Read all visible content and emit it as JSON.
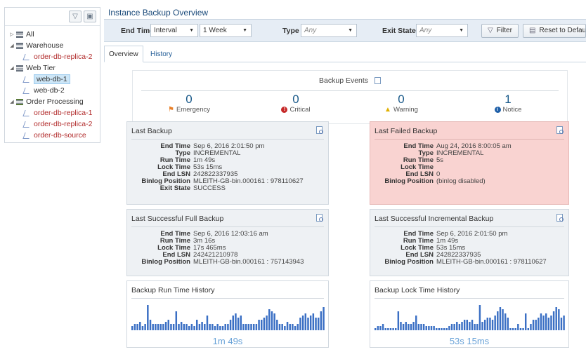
{
  "tree": {
    "items": [
      {
        "label": "All",
        "level": 0,
        "kind": "group",
        "expand": "closed",
        "color": "normal"
      },
      {
        "label": "Warehouse",
        "level": 0,
        "kind": "group",
        "expand": "open",
        "color": "normal"
      },
      {
        "label": "order-db-replica-2",
        "level": 1,
        "kind": "instance",
        "expand": "none",
        "color": "red"
      },
      {
        "label": "Web Tier",
        "level": 0,
        "kind": "group",
        "expand": "open",
        "color": "normal"
      },
      {
        "label": "web-db-1",
        "level": 1,
        "kind": "instance",
        "expand": "none",
        "color": "normal",
        "selected": true
      },
      {
        "label": "web-db-2",
        "level": 1,
        "kind": "instance",
        "expand": "none",
        "color": "normal"
      },
      {
        "label": "Order Processing",
        "level": 0,
        "kind": "group-green",
        "expand": "open",
        "color": "normal"
      },
      {
        "label": "order-db-replica-1",
        "level": 1,
        "kind": "instance",
        "expand": "none",
        "color": "red"
      },
      {
        "label": "order-db-replica-2",
        "level": 1,
        "kind": "instance",
        "expand": "none",
        "color": "red"
      },
      {
        "label": "order-db-source",
        "level": 1,
        "kind": "instance",
        "expand": "none",
        "color": "red"
      }
    ]
  },
  "header": {
    "title": "Instance Backup Overview"
  },
  "filters": {
    "end_time_label": "End Time",
    "end_time_mode": "Interval",
    "end_time_range": "1 Week",
    "type_label": "Type",
    "type_value": "Any",
    "exit_state_label": "Exit State",
    "exit_state_value": "Any",
    "filter_button": "Filter",
    "reset_button": "Reset to Default"
  },
  "tabs": [
    {
      "label": "Overview",
      "active": true
    },
    {
      "label": "History",
      "active": false
    }
  ],
  "events": {
    "title": "Backup Events",
    "items": [
      {
        "count": "0",
        "label": "Emergency",
        "color": "#e8802a"
      },
      {
        "count": "0",
        "label": "Critical",
        "color": "#c62828"
      },
      {
        "count": "0",
        "label": "Warning",
        "color": "#e0b000"
      },
      {
        "count": "1",
        "label": "Notice",
        "color": "#1e5fa8"
      }
    ]
  },
  "last_backup": {
    "title": "Last Backup",
    "fields": [
      {
        "k": "End Time",
        "v": "Sep 6, 2016 2:01:50 pm"
      },
      {
        "k": "Type",
        "v": "INCREMENTAL"
      },
      {
        "k": "Run Time",
        "v": "1m 49s"
      },
      {
        "k": "Lock Time",
        "v": "53s 15ms"
      },
      {
        "k": "End LSN",
        "v": "242822337935"
      },
      {
        "k": "Binlog Position",
        "v": "MLEITH-GB-bin.000161 : 978110627"
      },
      {
        "k": "Exit State",
        "v": "SUCCESS"
      }
    ]
  },
  "last_failed": {
    "title": "Last Failed Backup",
    "fields": [
      {
        "k": "End Time",
        "v": "Aug 24, 2016 8:00:05 am"
      },
      {
        "k": "Type",
        "v": "INCREMENTAL"
      },
      {
        "k": "Run Time",
        "v": "5s"
      },
      {
        "k": "Lock Time",
        "v": ""
      },
      {
        "k": "End LSN",
        "v": "0"
      },
      {
        "k": "Binlog Position",
        "v": "(binlog disabled)"
      }
    ]
  },
  "last_full": {
    "title": "Last Successful Full Backup",
    "fields": [
      {
        "k": "End Time",
        "v": "Sep 6, 2016 12:03:16 am"
      },
      {
        "k": "Run Time",
        "v": "3m 16s"
      },
      {
        "k": "Lock Time",
        "v": "17s 465ms"
      },
      {
        "k": "End LSN",
        "v": "242421210978"
      },
      {
        "k": "Binlog Position",
        "v": "MLEITH-GB-bin.000161 : 757143943"
      }
    ]
  },
  "last_incremental": {
    "title": "Last Successful Incremental Backup",
    "fields": [
      {
        "k": "End Time",
        "v": "Sep 6, 2016 2:01:50 pm"
      },
      {
        "k": "Run Time",
        "v": "1m 49s"
      },
      {
        "k": "Lock Time",
        "v": "53s 15ms"
      },
      {
        "k": "End LSN",
        "v": "242822337935"
      },
      {
        "k": "Binlog Position",
        "v": "MLEITH-GB-bin.000161 : 978110627"
      }
    ]
  },
  "run_chart": {
    "title": "Backup Run Time History",
    "current": "1m 49s",
    "color": "#3a6fc4",
    "values": [
      2,
      3,
      3,
      4,
      2,
      3,
      12,
      5,
      3,
      3,
      3,
      3,
      3,
      4,
      5,
      3,
      3,
      9,
      3,
      4,
      3,
      3,
      2,
      3,
      2,
      5,
      3,
      4,
      3,
      7,
      3,
      3,
      2,
      3,
      2,
      2,
      3,
      3,
      5,
      7,
      8,
      6,
      7,
      3,
      3,
      3,
      3,
      3,
      3,
      5,
      5,
      6,
      7,
      10,
      9,
      8,
      5,
      3,
      3,
      2,
      4,
      3,
      3,
      2,
      3,
      6,
      7,
      8,
      6,
      7,
      8,
      6,
      6,
      9,
      11
    ]
  },
  "lock_chart": {
    "title": "Backup Lock Time History",
    "current": "53s 15ms",
    "color": "#3a6fc4",
    "values": [
      1,
      2,
      2,
      3,
      1,
      1,
      1,
      1,
      1,
      9,
      4,
      3,
      4,
      3,
      3,
      4,
      7,
      3,
      3,
      3,
      2,
      2,
      2,
      2,
      1,
      1,
      1,
      1,
      1,
      2,
      3,
      3,
      4,
      3,
      4,
      5,
      5,
      4,
      5,
      3,
      3,
      12,
      4,
      5,
      6,
      6,
      5,
      7,
      9,
      11,
      10,
      8,
      6,
      1,
      1,
      1,
      3,
      1,
      1,
      8,
      1,
      3,
      5,
      5,
      6,
      8,
      7,
      8,
      6,
      7,
      9,
      11,
      10,
      6,
      7
    ]
  }
}
